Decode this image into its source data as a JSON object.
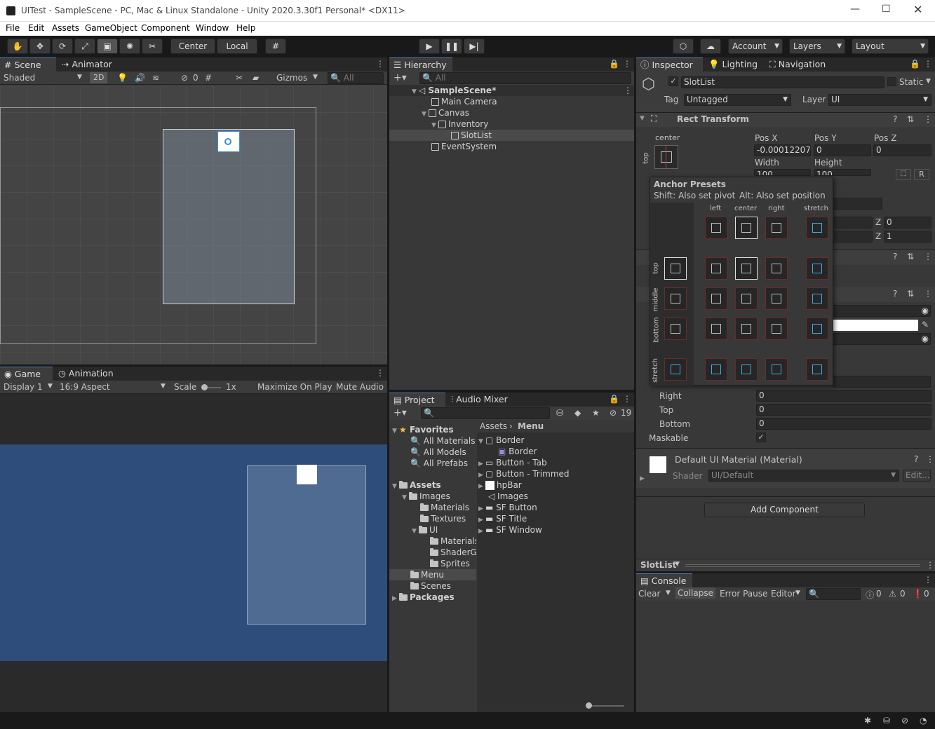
{
  "window": {
    "title": "UITest - SampleScene - PC, Mac & Linux Standalone - Unity 2020.3.30f1 Personal* <DX11>"
  },
  "menu": [
    "File",
    "Edit",
    "Assets",
    "GameObject",
    "Component",
    "Window",
    "Help"
  ],
  "toolbar": {
    "pivot": "Center",
    "space": "Local",
    "account": "Account",
    "layers": "Layers",
    "layout": "Layout"
  },
  "scene": {
    "tab_scene": "Scene",
    "tab_animator": "Animator",
    "shading": "Shaded",
    "mode2d": "2D",
    "hidden_count": "0",
    "gizmos": "Gizmos",
    "search": "All"
  },
  "game": {
    "tab_game": "Game",
    "tab_animation": "Animation",
    "display": "Display 1",
    "aspect": "16:9 Aspect",
    "scale_label": "Scale",
    "scale_value": "1x",
    "maximize": "Maximize On Play",
    "mute": "Mute Audio"
  },
  "hierarchy": {
    "tab": "Hierarchy",
    "search": "All",
    "items": [
      {
        "label": "SampleScene*"
      },
      {
        "label": "Main Camera"
      },
      {
        "label": "Canvas"
      },
      {
        "label": "Inventory"
      },
      {
        "label": "SlotList"
      },
      {
        "label": "EventSystem"
      }
    ]
  },
  "project": {
    "tab_project": "Project",
    "tab_audio": "Audio Mixer",
    "hidden_count": "19",
    "favorites": "Favorites",
    "fav_items": [
      "All Materials",
      "All Models",
      "All Prefabs"
    ],
    "assets": "Assets",
    "tree": [
      "Images",
      "Materials",
      "Textures",
      "UI",
      "Materials",
      "ShaderG",
      "Sprites",
      "Menu",
      "Scenes"
    ],
    "packages": "Packages",
    "breadcrumb_root": "Assets",
    "breadcrumb_leaf": "Menu",
    "files": [
      "Border",
      "Border",
      "Button - Tab",
      "Button - Trimmed",
      "hpBar",
      "Images",
      "SF Button",
      "SF Title",
      "SF Window"
    ]
  },
  "inspector": {
    "tab_inspector": "Inspector",
    "tab_lighting": "Lighting",
    "tab_navigation": "Navigation",
    "object_name": "SlotList",
    "static": "Static",
    "tag_label": "Tag",
    "tag_value": "Untagged",
    "layer_label": "Layer",
    "layer_value": "UI",
    "rect_transform": "Rect Transform",
    "anchor_label": "center",
    "anchor_side": "top",
    "posx_label": "Pos X",
    "posy_label": "Pos Y",
    "posz_label": "Pos Z",
    "posx": "-0.00012207",
    "posy": "0",
    "posz": "0",
    "width_label": "Width",
    "height_label": "Height",
    "width": "100",
    "height": "100",
    "r_btn": "R",
    "z1_label": "Z",
    "z1": "0",
    "z2_label": "Z",
    "z2": "1",
    "right_label": "Right",
    "top_label": "Top",
    "bottom_label": "Bottom",
    "right": "0",
    "top": "0",
    "bottom": "0",
    "maskable": "Maskable",
    "material": "Default UI Material (Material)",
    "shader_label": "Shader",
    "shader_value": "UI/Default",
    "edit": "Edit...",
    "add_component": "Add Component"
  },
  "anchor_presets": {
    "title": "Anchor Presets",
    "shift": "Shift: Also set pivot",
    "alt": "Alt: Also set position",
    "cols": [
      "left",
      "center",
      "right",
      "stretch"
    ],
    "rows": [
      "top",
      "middle",
      "bottom",
      "stretch"
    ]
  },
  "preview": {
    "label": "SlotList"
  },
  "console": {
    "tab": "Console",
    "clear": "Clear",
    "collapse": "Collapse",
    "error_pause": "Error Pause",
    "editor": "Editor",
    "count_info": "0",
    "count_warn": "0",
    "count_err": "0"
  },
  "colors": {
    "accent": "#4a80c0",
    "game_bg": "#2e4d7b",
    "selection": "#2c5d87"
  }
}
